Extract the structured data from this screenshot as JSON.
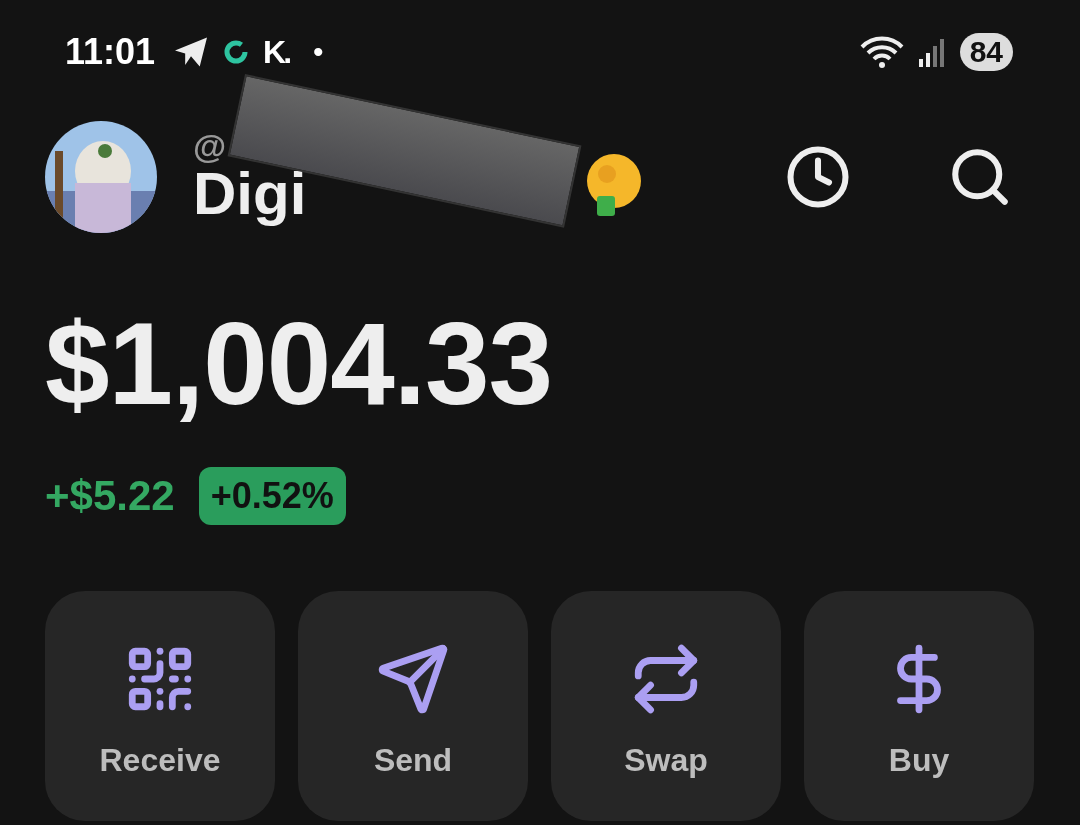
{
  "status_bar": {
    "time": "11:01",
    "app_logo": "K.",
    "dot": "•",
    "battery": "84"
  },
  "profile": {
    "handle": "@",
    "name": "Digi",
    "redacted": true
  },
  "balance": {
    "amount": "$1,004.33",
    "change": "+$5.22",
    "percent": "+0.52%"
  },
  "actions": [
    {
      "label": "Receive",
      "kind": "qr"
    },
    {
      "label": "Send",
      "kind": "send"
    },
    {
      "label": "Swap",
      "kind": "swap"
    },
    {
      "label": "Buy",
      "kind": "dollar"
    }
  ]
}
